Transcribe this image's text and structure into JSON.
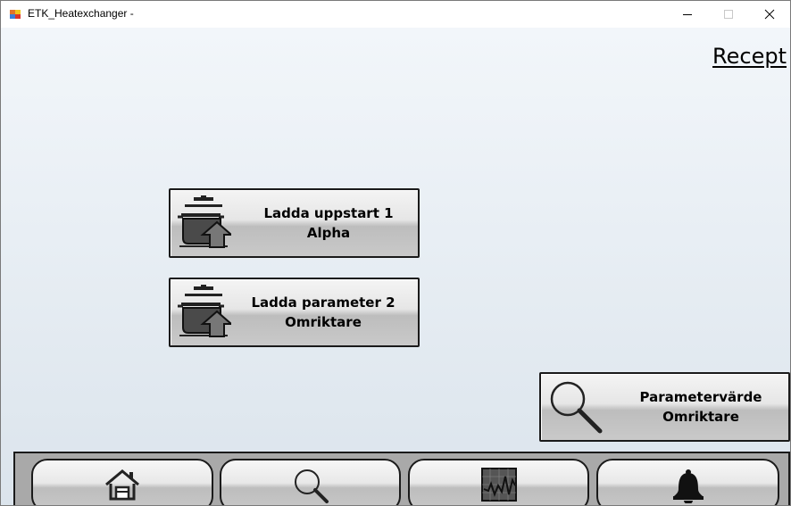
{
  "window": {
    "title": "ETK_Heatexchanger -",
    "icon": "app-window-icon",
    "controls": [
      "minimize-icon",
      "maximize-icon",
      "close-icon"
    ]
  },
  "page": {
    "title": "Recept"
  },
  "actions": [
    {
      "line1": "Ladda uppstart 1",
      "line2": "Alpha",
      "icon": "pot-load-icon"
    },
    {
      "line1": "Ladda parameter 2",
      "line2": "Omriktare",
      "icon": "pot-load-icon"
    },
    {
      "line1": "Parametervärde",
      "line2": "Omriktare",
      "icon": "magnifier-icon"
    }
  ],
  "nav": [
    {
      "icon": "home-icon"
    },
    {
      "icon": "search-icon"
    },
    {
      "icon": "trend-chart-icon"
    },
    {
      "icon": "alarm-bell-icon"
    }
  ],
  "colors": {
    "background_top": "#f2f6fa",
    "background_bottom": "#dbe4ec",
    "navbar": "#a9a9a9",
    "border": "#1a1a1a"
  }
}
